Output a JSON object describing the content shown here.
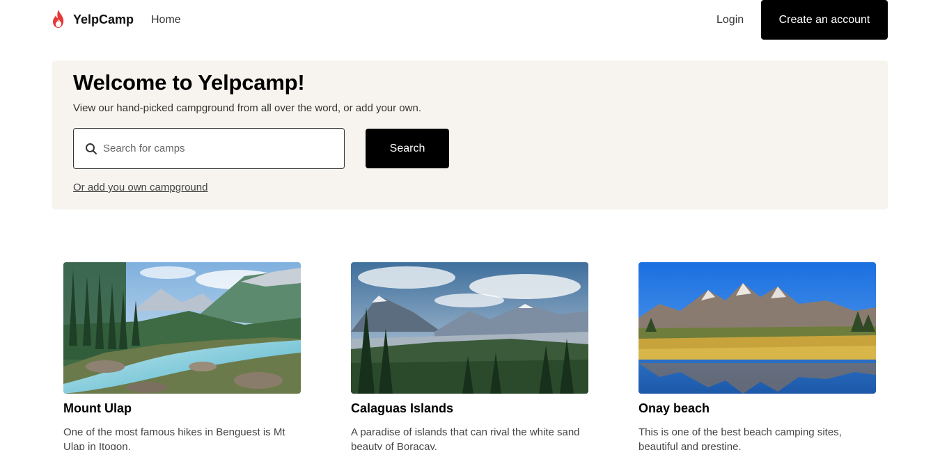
{
  "nav": {
    "brand": "YelpCamp",
    "home": "Home",
    "login": "Login",
    "create_account": "Create an account"
  },
  "hero": {
    "title": "Welcome to Yelpcamp!",
    "subtitle": "View our hand-picked campground from all over the word, or add your own.",
    "search_placeholder": "Search for camps",
    "search_button": "Search",
    "add_link": "Or add you own campground"
  },
  "campgrounds": [
    {
      "title": "Mount Ulap",
      "description": "One of the most famous hikes in Benguest is Mt Ulap in Itogon."
    },
    {
      "title": "Calaguas Islands",
      "description": "A paradise of islands that can rival the white sand beauty of Boracay."
    },
    {
      "title": "Onay beach",
      "description": "This is one of the best beach camping sites, beautiful and prestine."
    }
  ],
  "icons": {
    "logo": "flame-icon",
    "search": "search-icon"
  },
  "colors": {
    "accent": "#000000",
    "logo": "#e53935",
    "hero_bg": "#f7f4ef"
  }
}
